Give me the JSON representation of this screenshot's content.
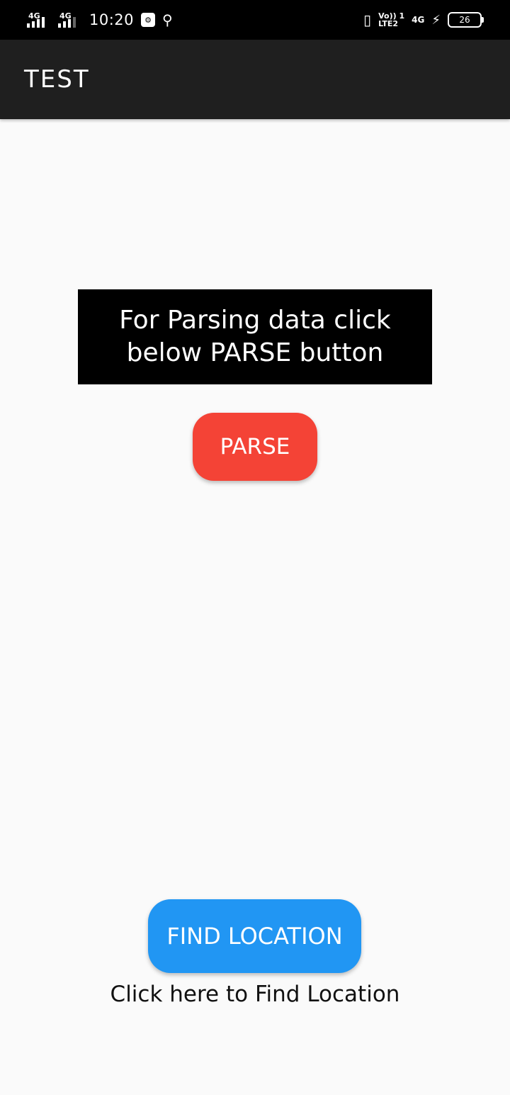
{
  "status_bar": {
    "sim1_network": "4G",
    "sim2_network": "4G",
    "time": "10:20",
    "notification_icon": "usb-debug-icon",
    "usb_icon": "usb-icon",
    "vibrate_icon": "vibrate-icon",
    "volte_line1": "Vo)) 1",
    "volte_line2": "LTE2",
    "data_network": "4G",
    "charging_icon": "bolt-icon",
    "battery_level": "26"
  },
  "app_bar": {
    "title": "TEST",
    "background": "#1f1f1f"
  },
  "main": {
    "info_text": "For Parsing data click below PARSE button",
    "parse_button_label": "PARSE",
    "parse_button_color": "#f44336",
    "find_location_label": "FIND LOCATION",
    "find_location_color": "#2196f3",
    "find_location_caption": "Click here to Find Location"
  }
}
